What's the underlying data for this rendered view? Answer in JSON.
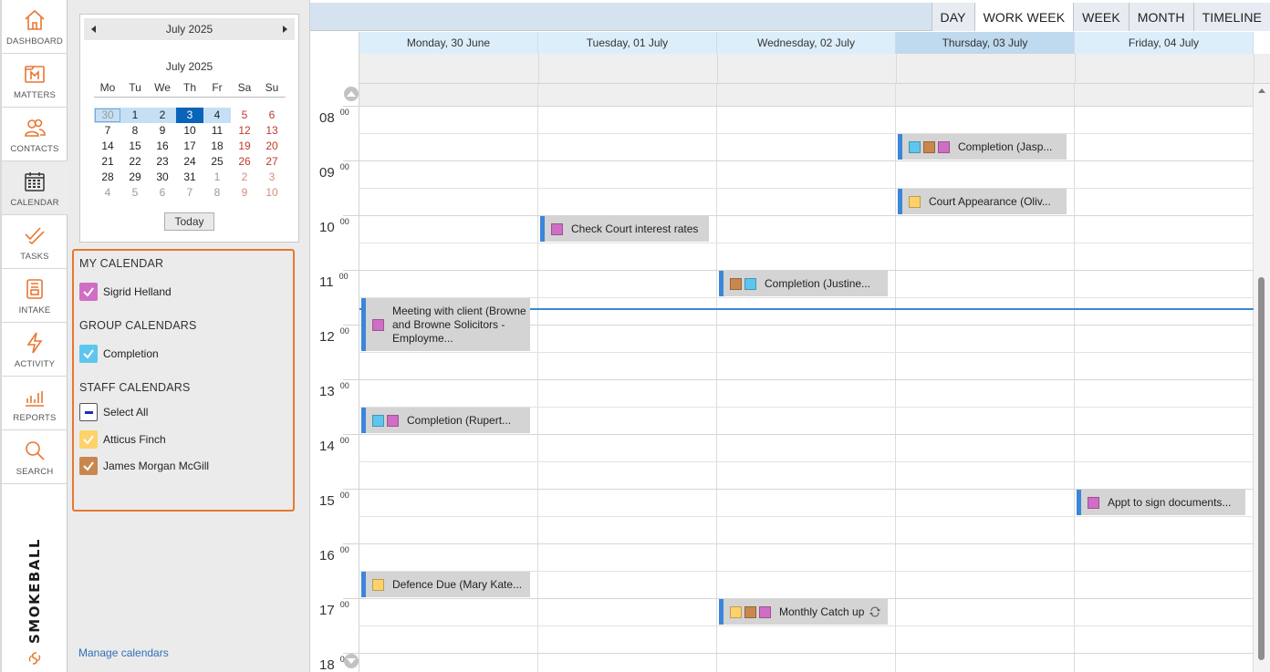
{
  "nav": {
    "items": [
      {
        "label": "DASHBOARD",
        "icon": "home-icon"
      },
      {
        "label": "MATTERS",
        "icon": "matters-icon"
      },
      {
        "label": "CONTACTS",
        "icon": "contacts-icon"
      },
      {
        "label": "CALENDAR",
        "icon": "calendar-icon"
      },
      {
        "label": "TASKS",
        "icon": "tasks-icon"
      },
      {
        "label": "INTAKE",
        "icon": "intake-icon"
      },
      {
        "label": "ACTIVITY",
        "icon": "activity-icon"
      },
      {
        "label": "REPORTS",
        "icon": "reports-icon"
      },
      {
        "label": "SEARCH",
        "icon": "search-icon"
      }
    ],
    "active": "CALENDAR",
    "brand": "SMOKEBALL"
  },
  "mini_calendar": {
    "header": "July 2025",
    "month_title": "July 2025",
    "weekdays": [
      "Mo",
      "Tu",
      "We",
      "Th",
      "Fr",
      "Sa",
      "Su"
    ],
    "weeks": [
      [
        "30",
        "1",
        "2",
        "3",
        "4",
        "5",
        "6"
      ],
      [
        "7",
        "8",
        "9",
        "10",
        "11",
        "12",
        "13"
      ],
      [
        "14",
        "15",
        "16",
        "17",
        "18",
        "19",
        "20"
      ],
      [
        "21",
        "22",
        "23",
        "24",
        "25",
        "26",
        "27"
      ],
      [
        "28",
        "29",
        "30",
        "31",
        "1",
        "2",
        "3"
      ],
      [
        "4",
        "5",
        "6",
        "7",
        "8",
        "9",
        "10"
      ]
    ],
    "selected": "3",
    "today_label": "Today"
  },
  "calendars": {
    "my_title": "MY CALENDAR",
    "my": [
      {
        "name": "Sigrid Helland",
        "color": "#cf6ec4",
        "state": "checked"
      }
    ],
    "group_title": "GROUP CALENDARS",
    "group": [
      {
        "name": "Completion",
        "color": "#5ec6ee",
        "state": "checked"
      }
    ],
    "staff_title": "STAFF CALENDARS",
    "staff": [
      {
        "name": "Select All",
        "color": "#ffffff",
        "state": "partial"
      },
      {
        "name": "Atticus Finch",
        "color": "#fdd26b",
        "state": "checked"
      },
      {
        "name": "James Morgan McGill",
        "color": "#c9874f",
        "state": "checked"
      }
    ],
    "manage_label": "Manage calendars"
  },
  "views": {
    "tabs": [
      "DAY",
      "WORK WEEK",
      "WEEK",
      "MONTH",
      "TIMELINE"
    ],
    "active": "WORK WEEK"
  },
  "days": [
    {
      "label": "Monday, 30 June",
      "today": false
    },
    {
      "label": "Tuesday, 01 July",
      "today": false
    },
    {
      "label": "Wednesday, 02 July",
      "today": false
    },
    {
      "label": "Thursday, 03 July",
      "today": true
    },
    {
      "label": "Friday, 04 July",
      "today": false
    }
  ],
  "hours": [
    "08",
    "09",
    "10",
    "11",
    "12",
    "13",
    "14",
    "15",
    "16",
    "17",
    "18"
  ],
  "minutes_label": "00",
  "colors": {
    "sigrid": "#cf6ec4",
    "completion": "#5ec6ee",
    "atticus": "#fdd26b",
    "james": "#c9874f",
    "accent": "#3b86d9",
    "highlight": "#e87731"
  },
  "events": [
    {
      "day": 3,
      "start": 8.5,
      "end": 9.0,
      "title": "Completion (Jasp...",
      "swatches": [
        "completion",
        "james",
        "sigrid"
      ]
    },
    {
      "day": 3,
      "start": 9.5,
      "end": 10.0,
      "title": "Court Appearance (Oliv...",
      "swatches": [
        "atticus"
      ]
    },
    {
      "day": 1,
      "start": 10.0,
      "end": 10.5,
      "title": "Check Court interest rates",
      "swatches": [
        "sigrid"
      ]
    },
    {
      "day": 2,
      "start": 11.0,
      "end": 11.5,
      "title": "Completion (Justine...",
      "swatches": [
        "james",
        "completion"
      ]
    },
    {
      "day": 0,
      "start": 11.5,
      "end": 12.5,
      "title": "Meeting with client (Browne and Browne Solicitors - Employme...",
      "swatches": [
        "sigrid"
      ]
    },
    {
      "day": 0,
      "start": 13.5,
      "end": 14.0,
      "title": "Completion (Rupert...",
      "swatches": [
        "completion",
        "sigrid"
      ]
    },
    {
      "day": 4,
      "start": 15.0,
      "end": 15.5,
      "title": "Appt to sign documents...",
      "swatches": [
        "sigrid"
      ]
    },
    {
      "day": 0,
      "start": 16.5,
      "end": 17.0,
      "title": "Defence Due (Mary Kate...",
      "swatches": [
        "atticus"
      ]
    },
    {
      "day": 2,
      "start": 17.0,
      "end": 17.5,
      "title": "Monthly Catch up",
      "swatches": [
        "atticus",
        "james",
        "sigrid"
      ],
      "recurring": true
    }
  ]
}
